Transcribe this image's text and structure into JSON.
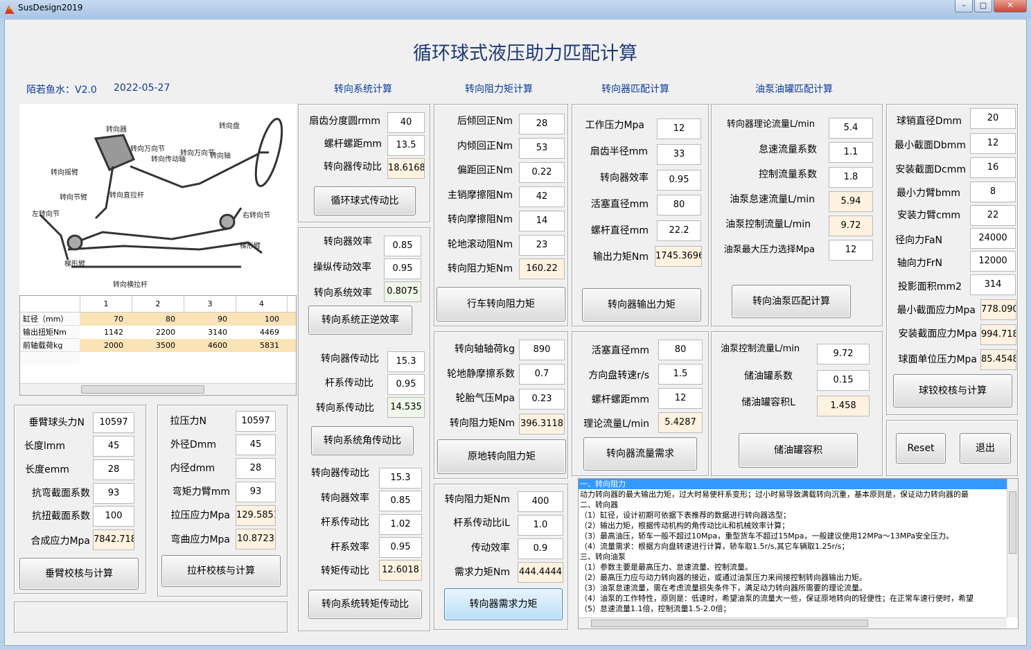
{
  "window": {
    "title": "SusDesign2019"
  },
  "main_title": "循环球式液压助力匹配计算",
  "author": "陌若鱼水：V2.0",
  "date": "2022-05-27",
  "headers": {
    "steering_system": "转向系统计算",
    "resistance": "转向阻力矩计算",
    "gear_match": "转向器匹配计算",
    "pump_tank": "油泵油罐匹配计算"
  },
  "diagram_labels": {
    "gear": "转向器",
    "wheel": "转向盘",
    "ujoint": "转向万向节",
    "drive_shaft": "转向传动轴",
    "ujoint2": "转向万向节",
    "shaft": "转向轴",
    "drop_arm": "转向摇臂",
    "knuckle_arm": "转向节臂",
    "drag_link": "转向直拉杆",
    "left_knuckle": "左转向节",
    "right_knuckle": "右转向节",
    "trapezoid_arm1": "梯形臂",
    "trapezoid_arm2": "梯形臂",
    "tie_rod": "转向横拉杆"
  },
  "table": {
    "columns": [
      "1",
      "2",
      "3",
      "4"
    ],
    "rows": [
      {
        "label": "缸径（mm）",
        "values": [
          "70",
          "80",
          "90",
          "100"
        ]
      },
      {
        "label": "输出扭矩Nm",
        "values": [
          "1142",
          "2200",
          "3140",
          "4469"
        ]
      },
      {
        "label": "前轴载荷kg",
        "values": [
          "2000",
          "3500",
          "4600",
          "5831"
        ]
      }
    ]
  },
  "pitman": {
    "fields": [
      {
        "label": "垂臂球头力N",
        "value": "10597"
      },
      {
        "label": "长度lmm",
        "value": "45"
      },
      {
        "label": "长度emm",
        "value": "28"
      },
      {
        "label": "抗弯截面系数",
        "value": "93"
      },
      {
        "label": "抗扭截面系数",
        "value": "100"
      },
      {
        "label": "合成应力Mpa",
        "value": "7842.718"
      }
    ],
    "button": "垂臂校核与计算"
  },
  "tierod": {
    "fields": [
      {
        "label": "拉压力N",
        "value": "10597"
      },
      {
        "label": "外径Dmm",
        "value": "45"
      },
      {
        "label": "内径dmm",
        "value": "28"
      },
      {
        "label": "弯矩力臂mm",
        "value": "93"
      },
      {
        "label": "拉压应力Mpa",
        "value": "129.5851"
      },
      {
        "label": "弯曲应力Mpa",
        "value": "10.8723"
      }
    ],
    "button": "拉杆校核与计算"
  },
  "ratio": {
    "fields": [
      {
        "label": "扇齿分度圆rmm",
        "value": "40"
      },
      {
        "label": "螺杆螺距mm",
        "value": "13.5"
      },
      {
        "label": "转向器传动比",
        "value": "18.6168"
      }
    ],
    "button": "循环球式传动比"
  },
  "efficiency": {
    "fields": [
      {
        "label": "转向器效率",
        "value": "0.85"
      },
      {
        "label": "操纵传动效率",
        "value": "0.95"
      },
      {
        "label": "转向系统效率",
        "value": "0.8075"
      }
    ],
    "button": "转向系统正逆效率"
  },
  "angle_ratio": {
    "fields": [
      {
        "label": "转向器传动比",
        "value": "15.3"
      },
      {
        "label": "杆系传动比",
        "value": "0.95"
      },
      {
        "label": "转向系传动比",
        "value": "14.535"
      }
    ],
    "button": "转向系统角传动比"
  },
  "torque_ratio": {
    "fields": [
      {
        "label": "转向器传动比",
        "value": "15.3"
      },
      {
        "label": "转向器效率",
        "value": "0.85"
      },
      {
        "label": "杆系传动比",
        "value": "1.02"
      },
      {
        "label": "杆系效率",
        "value": "0.95"
      },
      {
        "label": "转矩传动比",
        "value": "12.6018"
      }
    ],
    "button": "转向系统转矩传动比"
  },
  "driving_res": {
    "fields": [
      {
        "label": "后倾回正Nm",
        "value": "28"
      },
      {
        "label": "内倾回正Nm",
        "value": "53"
      },
      {
        "label": "偏距回正Nm",
        "value": "0.22"
      },
      {
        "label": "主销摩擦阻Nm",
        "value": "42"
      },
      {
        "label": "转向摩擦阻Nm",
        "value": "14"
      },
      {
        "label": "轮地滚动阻Nm",
        "value": "23"
      },
      {
        "label": "转向阻力矩Nm",
        "value": "160.22"
      }
    ],
    "button": "行车转向阻力矩"
  },
  "inplace_res": {
    "fields": [
      {
        "label": "转向轴轴荷kg",
        "value": "890"
      },
      {
        "label": "轮地静摩擦系数",
        "value": "0.7"
      },
      {
        "label": "轮胎气压Mpa",
        "value": "0.23"
      },
      {
        "label": "转向阻力矩Nm",
        "value": "396.3118"
      }
    ],
    "button": "原地转向阻力矩"
  },
  "demand": {
    "fields": [
      {
        "label": "转向阻力矩Nm",
        "value": "400"
      },
      {
        "label": "杆系传动比iL",
        "value": "1.0"
      },
      {
        "label": "传动效率",
        "value": "0.9"
      },
      {
        "label": "需求力矩Nm",
        "value": "444.4444"
      }
    ],
    "button": "转向器需求力矩"
  },
  "gear_out": {
    "fields": [
      {
        "label": "工作压力Mpa",
        "value": "12"
      },
      {
        "label": "扇齿半径mm",
        "value": "33"
      },
      {
        "label": "转向器效率",
        "value": "0.95"
      },
      {
        "label": "活塞直径mm",
        "value": "80"
      },
      {
        "label": "螺杆直径mm",
        "value": "22.2"
      },
      {
        "label": "输出力矩Nm",
        "value": "1745.3696"
      }
    ],
    "button": "转向器输出力矩"
  },
  "flow": {
    "fields": [
      {
        "label": "活塞直径mm",
        "value": "80"
      },
      {
        "label": "方向盘转速r/s",
        "value": "1.5"
      },
      {
        "label": "螺杆螺距mm",
        "value": "12"
      },
      {
        "label": "理论流量L/min",
        "value": "5.4287"
      }
    ],
    "button": "转向器流量需求"
  },
  "pump": {
    "fields": [
      {
        "label": "转向器理论流量L/min",
        "value": "5.4"
      },
      {
        "label": "怠速流量系数",
        "value": "1.1"
      },
      {
        "label": "控制流量系数",
        "value": "1.8"
      },
      {
        "label": "油泵怠速流量L/min",
        "value": "5.94"
      },
      {
        "label": "油泵控制流量L/min",
        "value": "9.72"
      },
      {
        "label": "油泵最大压力选择Mpa",
        "value": "12"
      }
    ],
    "button": "转向油泵匹配计算"
  },
  "tank": {
    "fields": [
      {
        "label": "油泵控制流量L/min",
        "value": "9.72"
      },
      {
        "label": "储油罐系数",
        "value": "0.15"
      },
      {
        "label": "储油罐容积L",
        "value": "1.458"
      }
    ],
    "button": "储油罐容积"
  },
  "ball": {
    "fields": [
      {
        "label": "球销直径Dmm",
        "value": "20"
      },
      {
        "label": "最小截面Dbmm",
        "value": "12"
      },
      {
        "label": "安装截面Dcmm",
        "value": "16"
      },
      {
        "label": "最小力臂bmm",
        "value": "8"
      },
      {
        "label": "安装力臂cmm",
        "value": "22"
      },
      {
        "label": "径向力FaN",
        "value": "24000"
      },
      {
        "label": "轴向力FrN",
        "value": "12000"
      },
      {
        "label": "投影面积mm2",
        "value": "314"
      },
      {
        "label": "最小截面应力Mpa",
        "value": "778.090"
      },
      {
        "label": "安装截面应力Mpa",
        "value": "994.718"
      },
      {
        "label": "球面单位压力Mpa",
        "value": "85.4548"
      }
    ],
    "button": "球铰校核与计算"
  },
  "buttons": {
    "reset": "Reset",
    "exit": "退出"
  },
  "notes": [
    "一、转向阻力",
    "动力转向器的最大输出力矩，过大时易使杆系变形；过小时易导致满载转向沉重，基本原则是，保证动力转向器的最",
    "二、转向器",
    "（1）缸径，设计初期可依据下表推荐的数据进行转向器选型；",
    "（2）输出力矩，根据传动机构的角传动比iL和机械效率计算；",
    "（3）最高油压，轿车一般不超过10Mpa，重型货车不超过15Mpa，一般建议使用12MPa～13MPa安全压力。",
    "（4）流量需求：根据方向盘转速进行计算，轿车取1.5r/s,其它车辆取1.25r/s；",
    "三、转向油泵",
    "（1）参数主要是最高压力、怠速流量、控制流量。",
    "（2）最高压力应与动力转向器的接近，或通过油泵压力来间接控制转向器输出力矩。",
    "（3）油泵怠速流量，需在考虑流量损失条件下，满足动力转向器所需要的理论流量。",
    "（4）油泵的工作特性，原则是：低速时，希望油泵的流量大一些，保证原地转向的轻便性；在正常车速行使时，希望",
    "（5）怠速流量1.1倍，控制流量1.5-2.0倍；"
  ],
  "colors": {
    "title": "#1f3a73",
    "header": "#0b3b98",
    "output_bg": "#fff2e0",
    "highlight": "#3399ff"
  }
}
